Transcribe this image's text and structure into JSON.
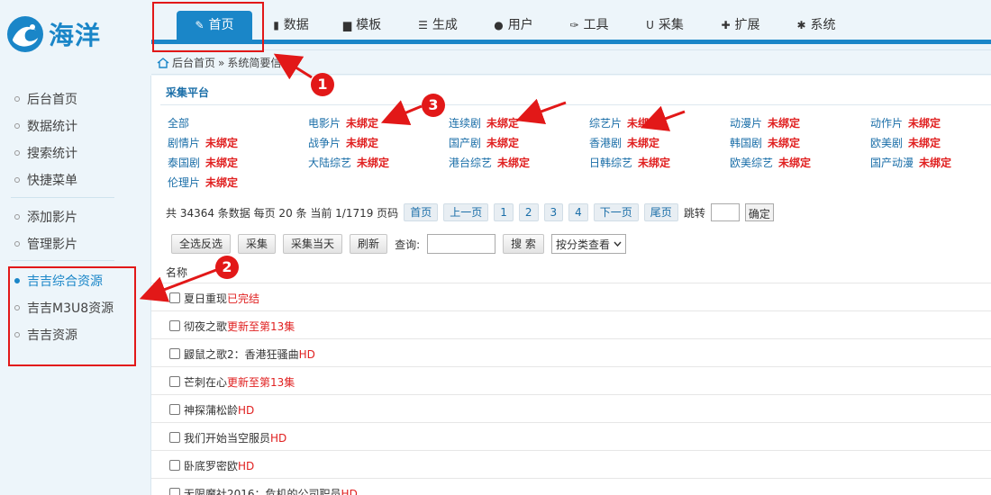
{
  "logo": {
    "text": "海洋"
  },
  "nav": [
    {
      "label": "首页",
      "icon": "edit-icon",
      "glyph": "✎",
      "active": true
    },
    {
      "label": "数据",
      "icon": "book-icon",
      "glyph": "▮"
    },
    {
      "label": "模板",
      "icon": "file-icon",
      "glyph": "▆"
    },
    {
      "label": "生成",
      "icon": "server-icon",
      "glyph": "☰"
    },
    {
      "label": "用户",
      "icon": "user-icon",
      "glyph": "●"
    },
    {
      "label": "工具",
      "icon": "wrench-icon",
      "glyph": "✑"
    },
    {
      "label": "采集",
      "icon": "magnet-icon",
      "glyph": "U"
    },
    {
      "label": "扩展",
      "icon": "puzzle-icon",
      "glyph": "✚"
    },
    {
      "label": "系统",
      "icon": "gear-icon",
      "glyph": "✱"
    }
  ],
  "breadcrumb": {
    "home": "后台首页",
    "sep": "»",
    "current": "系统简要信"
  },
  "sidebar": {
    "items": [
      {
        "label": "后台首页"
      },
      {
        "label": "数据统计"
      },
      {
        "label": "搜索统计"
      },
      {
        "label": "快捷菜单"
      },
      {
        "label": "添加影片"
      },
      {
        "label": "管理影片"
      },
      {
        "label": "吉吉综合资源",
        "active": true
      },
      {
        "label": "吉吉M3U8资源"
      },
      {
        "label": "吉吉资源"
      }
    ]
  },
  "platform": {
    "title": "采集平台",
    "categories": [
      {
        "name": "全部",
        "status": ""
      },
      {
        "name": "电影片",
        "status": "未绑定"
      },
      {
        "name": "连续剧",
        "status": "未绑定"
      },
      {
        "name": "综艺片",
        "status": "未绑定"
      },
      {
        "name": "动漫片",
        "status": "未绑定"
      },
      {
        "name": "动作片",
        "status": "未绑定"
      },
      {
        "name": "剧情片",
        "status": "未绑定"
      },
      {
        "name": "战争片",
        "status": "未绑定"
      },
      {
        "name": "国产剧",
        "status": "未绑定"
      },
      {
        "name": "香港剧",
        "status": "未绑定"
      },
      {
        "name": "韩国剧",
        "status": "未绑定"
      },
      {
        "name": "欧美剧",
        "status": "未绑定"
      },
      {
        "name": "泰国剧",
        "status": "未绑定"
      },
      {
        "name": "大陆综艺",
        "status": "未绑定"
      },
      {
        "name": "港台综艺",
        "status": "未绑定"
      },
      {
        "name": "日韩综艺",
        "status": "未绑定"
      },
      {
        "name": "欧美综艺",
        "status": "未绑定"
      },
      {
        "name": "国产动漫",
        "status": "未绑定"
      },
      {
        "name": "伦理片",
        "status": "未绑定"
      }
    ]
  },
  "pager": {
    "summary": "共 34364 条数据 每页 20 条 当前 1/1719 页码",
    "first": "首页",
    "prev": "上一页",
    "pages": [
      "1",
      "2",
      "3",
      "4"
    ],
    "next": "下一页",
    "last": "尾页",
    "goto_label": "跳转",
    "goto_value": "",
    "ok": "确定"
  },
  "toolbar": {
    "select_all": "全选反选",
    "collect": "采集",
    "collect_today": "采集当天",
    "refresh": "刷新",
    "query_label": "查询:",
    "search_value": "",
    "search_button": "搜 索",
    "category_select": "按分类查看"
  },
  "list": {
    "header": "名称",
    "rows": [
      {
        "title": "夏日重现",
        "status": "已完结"
      },
      {
        "title": "彻夜之歌",
        "status": "更新至第13集"
      },
      {
        "title": "鼹鼠之歌2：香港狂骚曲",
        "status": "HD"
      },
      {
        "title": "芒刺在心",
        "status": "更新至第13集"
      },
      {
        "title": "神探蒲松龄",
        "status": "HD"
      },
      {
        "title": "我们开始当空服员",
        "status": "HD"
      },
      {
        "title": "卧底罗密欧",
        "status": "HD"
      },
      {
        "title": "无限魔社2016：危机的公司职员",
        "status": "HD"
      }
    ]
  },
  "annotations": {
    "marker1": "1",
    "marker2": "2",
    "marker3": "3",
    "color": "#e21818"
  },
  "colors": {
    "accent": "#1a86c8",
    "alert": "#e02020",
    "panel": "#edf5fa"
  }
}
